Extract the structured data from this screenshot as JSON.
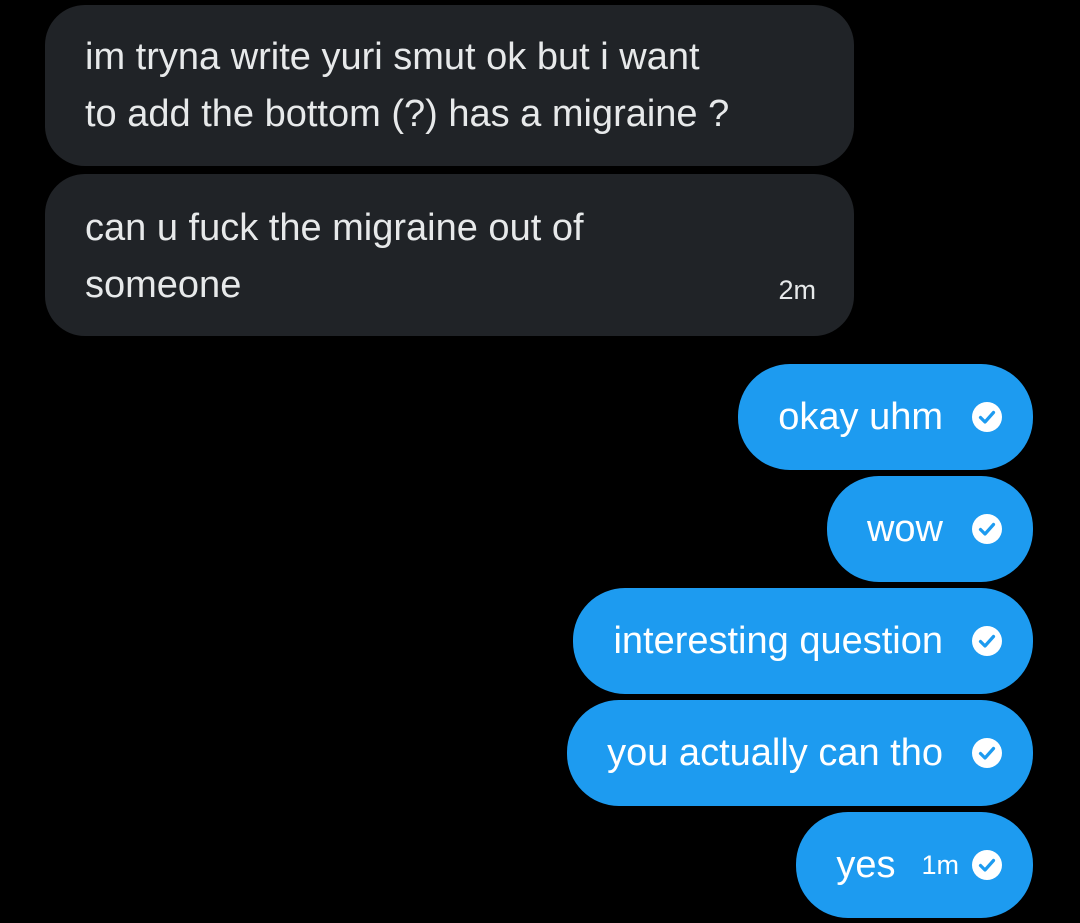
{
  "messages": [
    {
      "direction": "incoming",
      "text": "im tryna write yuri smut ok but i want\nto add the bottom (?) has a migraine ?"
    },
    {
      "direction": "incoming",
      "text": "can u fuck the migraine out of\nsomeone",
      "time": "2m"
    },
    {
      "direction": "outgoing",
      "text": "okay uhm",
      "status_icon": "sent-check-icon"
    },
    {
      "direction": "outgoing",
      "text": "wow",
      "status_icon": "sent-check-icon"
    },
    {
      "direction": "outgoing",
      "text": "interesting question",
      "status_icon": "sent-check-icon"
    },
    {
      "direction": "outgoing",
      "text": "you actually can tho",
      "status_icon": "sent-check-icon"
    },
    {
      "direction": "outgoing",
      "text": "yes",
      "time": "1m",
      "status_icon": "sent-check-icon"
    }
  ],
  "colors": {
    "background": "#000000",
    "incoming_bubble": "#202327",
    "outgoing_bubble": "#1d9bf0",
    "text": "#e7e9ea"
  }
}
